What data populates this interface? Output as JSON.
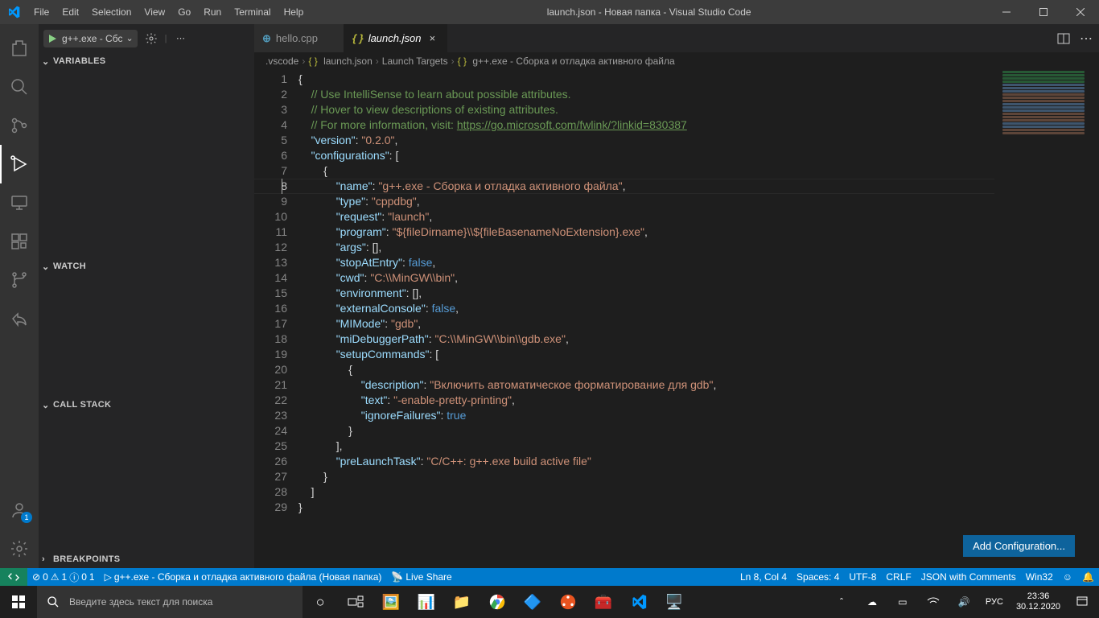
{
  "title": "launch.json - Новая папка - Visual Studio Code",
  "menu": [
    "File",
    "Edit",
    "Selection",
    "View",
    "Go",
    "Run",
    "Terminal",
    "Help"
  ],
  "activity_badge": "1",
  "debug": {
    "launch_label": "g++.exe - Сбс",
    "sections": {
      "variables": "VARIABLES",
      "watch": "WATCH",
      "callstack": "CALL STACK",
      "breakpoints": "BREAKPOINTS"
    }
  },
  "tabs": [
    {
      "icon_color": "#519aba",
      "label": "hello.cpp",
      "active": false
    },
    {
      "icon_color": "#b7b73b",
      "label": "launch.json",
      "active": true
    }
  ],
  "breadcrumb": [
    ".vscode",
    "launch.json",
    "Launch Targets",
    "g++.exe - Сборка и отладка активного файла"
  ],
  "code_lines": [
    [
      [
        "pun",
        "{"
      ]
    ],
    [
      [
        "sp",
        "    "
      ],
      [
        "cm",
        "// Use IntelliSense to learn about possible attributes."
      ]
    ],
    [
      [
        "sp",
        "    "
      ],
      [
        "cm",
        "// Hover to view descriptions of existing attributes."
      ]
    ],
    [
      [
        "sp",
        "    "
      ],
      [
        "cm",
        "// For more information, visit: "
      ],
      [
        "url",
        "https://go.microsoft.com/fwlink/?linkid=830387"
      ]
    ],
    [
      [
        "sp",
        "    "
      ],
      [
        "key",
        "\"version\""
      ],
      [
        "pun",
        ": "
      ],
      [
        "str",
        "\"0.2.0\""
      ],
      [
        "pun",
        ","
      ]
    ],
    [
      [
        "sp",
        "    "
      ],
      [
        "key",
        "\"configurations\""
      ],
      [
        "pun",
        ": ["
      ]
    ],
    [
      [
        "sp",
        "        "
      ],
      [
        "pun",
        "{"
      ]
    ],
    [
      [
        "sp",
        "            "
      ],
      [
        "key",
        "\"name\""
      ],
      [
        "pun",
        ": "
      ],
      [
        "str",
        "\"g++.exe - Сборка и отладка активного файла\""
      ],
      [
        "pun",
        ","
      ]
    ],
    [
      [
        "sp",
        "            "
      ],
      [
        "key",
        "\"type\""
      ],
      [
        "pun",
        ": "
      ],
      [
        "str",
        "\"cppdbg\""
      ],
      [
        "pun",
        ","
      ]
    ],
    [
      [
        "sp",
        "            "
      ],
      [
        "key",
        "\"request\""
      ],
      [
        "pun",
        ": "
      ],
      [
        "str",
        "\"launch\""
      ],
      [
        "pun",
        ","
      ]
    ],
    [
      [
        "sp",
        "            "
      ],
      [
        "key",
        "\"program\""
      ],
      [
        "pun",
        ": "
      ],
      [
        "str",
        "\"${fileDirname}\\\\${fileBasenameNoExtension}.exe\""
      ],
      [
        "pun",
        ","
      ]
    ],
    [
      [
        "sp",
        "            "
      ],
      [
        "key",
        "\"args\""
      ],
      [
        "pun",
        ": [],"
      ]
    ],
    [
      [
        "sp",
        "            "
      ],
      [
        "key",
        "\"stopAtEntry\""
      ],
      [
        "pun",
        ": "
      ],
      [
        "bool",
        "false"
      ],
      [
        "pun",
        ","
      ]
    ],
    [
      [
        "sp",
        "            "
      ],
      [
        "key",
        "\"cwd\""
      ],
      [
        "pun",
        ": "
      ],
      [
        "str",
        "\"C:\\\\MinGW\\\\bin\""
      ],
      [
        "pun",
        ","
      ]
    ],
    [
      [
        "sp",
        "            "
      ],
      [
        "key",
        "\"environment\""
      ],
      [
        "pun",
        ": [],"
      ]
    ],
    [
      [
        "sp",
        "            "
      ],
      [
        "key",
        "\"externalConsole\""
      ],
      [
        "pun",
        ": "
      ],
      [
        "bool",
        "false"
      ],
      [
        "pun",
        ","
      ]
    ],
    [
      [
        "sp",
        "            "
      ],
      [
        "key",
        "\"MIMode\""
      ],
      [
        "pun",
        ": "
      ],
      [
        "str",
        "\"gdb\""
      ],
      [
        "pun",
        ","
      ]
    ],
    [
      [
        "sp",
        "            "
      ],
      [
        "key",
        "\"miDebuggerPath\""
      ],
      [
        "pun",
        ": "
      ],
      [
        "str",
        "\"C:\\\\MinGW\\\\bin\\\\gdb.exe\""
      ],
      [
        "pun",
        ","
      ]
    ],
    [
      [
        "sp",
        "            "
      ],
      [
        "key",
        "\"setupCommands\""
      ],
      [
        "pun",
        ": ["
      ]
    ],
    [
      [
        "sp",
        "                "
      ],
      [
        "pun",
        "{"
      ]
    ],
    [
      [
        "sp",
        "                    "
      ],
      [
        "key",
        "\"description\""
      ],
      [
        "pun",
        ": "
      ],
      [
        "str",
        "\"Включить автоматическое форматирование для gdb\""
      ],
      [
        "pun",
        ","
      ]
    ],
    [
      [
        "sp",
        "                    "
      ],
      [
        "key",
        "\"text\""
      ],
      [
        "pun",
        ": "
      ],
      [
        "str",
        "\"-enable-pretty-printing\""
      ],
      [
        "pun",
        ","
      ]
    ],
    [
      [
        "sp",
        "                    "
      ],
      [
        "key",
        "\"ignoreFailures\""
      ],
      [
        "pun",
        ": "
      ],
      [
        "bool",
        "true"
      ]
    ],
    [
      [
        "sp",
        "                "
      ],
      [
        "pun",
        "}"
      ]
    ],
    [
      [
        "sp",
        "            "
      ],
      [
        "pun",
        "],"
      ]
    ],
    [
      [
        "sp",
        "            "
      ],
      [
        "key",
        "\"preLaunchTask\""
      ],
      [
        "pun",
        ": "
      ],
      [
        "str",
        "\"C/C++: g++.exe build active file\""
      ]
    ],
    [
      [
        "sp",
        "        "
      ],
      [
        "pun",
        "}"
      ]
    ],
    [
      [
        "sp",
        "    "
      ],
      [
        "pun",
        "]"
      ]
    ],
    [
      [
        "pun",
        "}"
      ]
    ]
  ],
  "current_line": 8,
  "add_config": "Add Configuration...",
  "status": {
    "errors": "0",
    "warnings": "1",
    "infos": "0",
    "changes": "1",
    "debug_target": "g++.exe - Сборка и отладка активного файла (Новая папка)",
    "liveshare": "Live Share",
    "ln_col": "Ln 8, Col 4",
    "spaces": "Spaces: 4",
    "enc": "UTF-8",
    "eol": "CRLF",
    "lang": "JSON with Comments",
    "port": "Win32",
    "feedback": "☺"
  },
  "taskbar": {
    "search_placeholder": "Введите здесь текст для поиска",
    "time": "23:36",
    "date": "30.12.2020",
    "lang": "РУС"
  }
}
